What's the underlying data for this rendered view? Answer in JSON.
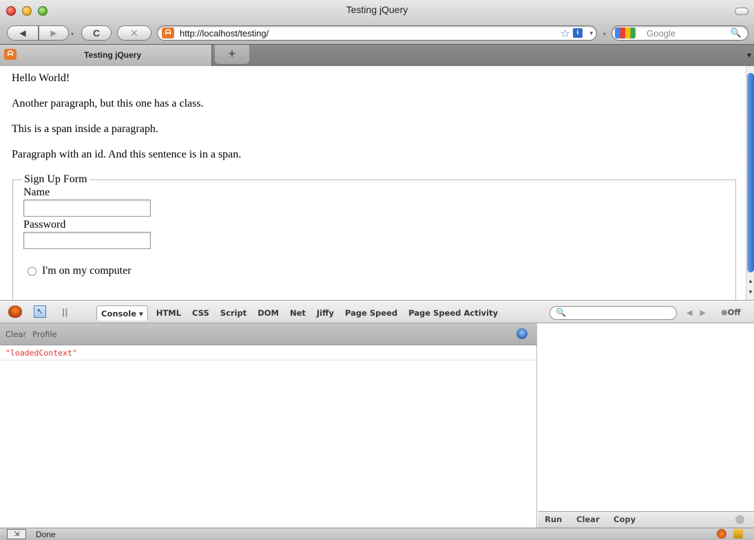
{
  "window": {
    "title": "Testing jQuery"
  },
  "nav": {
    "back_symbol": "◀",
    "forward_symbol": "▶",
    "dropdown_symbol": "▾",
    "reload_symbol": "C",
    "stop_symbol": "✕",
    "site_icon_glyph": "ᗩ",
    "url": "http://localhost/testing/",
    "star_symbol": "☆",
    "info_symbol": "i",
    "search_placeholder": "Google",
    "search_symbol": "🔍"
  },
  "tabs": {
    "active_label": "Testing jQuery",
    "new_tab_symbol": "+",
    "list_symbol": "▾"
  },
  "page": {
    "paragraphs": [
      "Hello World!",
      "Another paragraph, but this one has a class.",
      "This is a span inside a paragraph.",
      "Paragraph with an id. And this sentence is in a span."
    ],
    "form": {
      "legend": "Sign Up Form",
      "name_label": "Name",
      "name_value": "",
      "password_label": "Password",
      "password_value": "",
      "radio_label": "I'm on my computer"
    }
  },
  "firebug": {
    "inspect_symbol": "↖",
    "pause_symbol": "||",
    "tabs": [
      "Console ▾",
      "HTML",
      "CSS",
      "Script",
      "DOM",
      "Net",
      "Jiffy",
      "Page Speed",
      "Page Speed Activity"
    ],
    "active_tab_index": 0,
    "search_symbol": "🔍",
    "search_value": "",
    "nav_symbols": "◀ ▶",
    "off_label": "⊗Off",
    "sub_clear": "Clear",
    "sub_profile": "Profile",
    "console_output": "\"loadedContext\"",
    "right_run": "Run",
    "right_clear": "Clear",
    "right_copy": "Copy"
  },
  "status": {
    "text": "Done",
    "icon_symbol": "⇲"
  },
  "colors": {
    "accent_blue": "#2a6bcb",
    "console_error_red": "#e03030",
    "site_icon_orange": "#e8792a"
  }
}
